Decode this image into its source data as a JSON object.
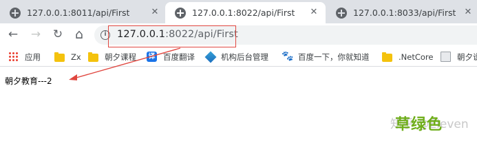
{
  "tabs": [
    {
      "title": "127.0.0.1:8011/api/First",
      "active": false
    },
    {
      "title": "127.0.0.1:8022/api/First",
      "active": true
    },
    {
      "title": "127.0.0.1:8033/api/First",
      "active": false
    }
  ],
  "toolbar": {
    "back_icon": "←",
    "forward_icon": "→",
    "reload_icon": "↻",
    "home_icon": "⌂",
    "info_icon": "i"
  },
  "address_bar": {
    "host": "127.0.0.1",
    "rest": ":8022/api/First"
  },
  "bookmarks": [
    {
      "label": "应用",
      "icon": "apps-icon"
    },
    {
      "label": "Zx",
      "icon": "folder-icon"
    },
    {
      "label": "朝夕课程",
      "icon": "folder-icon"
    },
    {
      "label": "百度翻译",
      "icon": "translate-icon"
    },
    {
      "label": "机构后台管理",
      "icon": "diamond-icon"
    },
    {
      "label": "百度一下，你就知道",
      "icon": "paw-icon"
    },
    {
      "label": ".NetCore",
      "icon": "folder-icon"
    },
    {
      "label": "朝夕说",
      "icon": "page-icon"
    }
  ],
  "content": {
    "text": "朝夕教育---2"
  },
  "overlay": {
    "watermark": "知乎 @Eleven",
    "label": "草绿色"
  },
  "colors": {
    "highlight_red": "#e0463f",
    "label_green": "#6fae1a"
  }
}
